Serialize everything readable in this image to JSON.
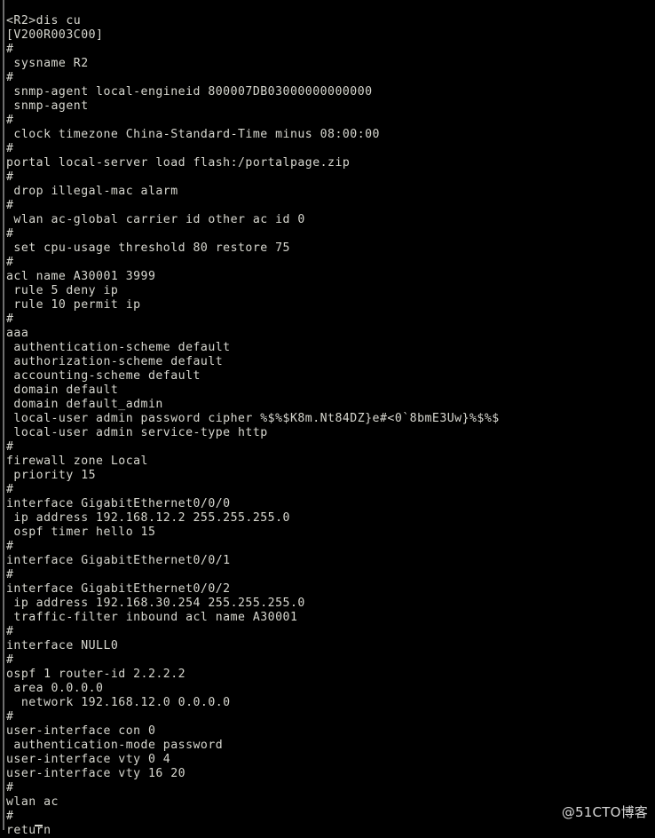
{
  "terminal": {
    "background_color": "#000000",
    "text_color": "#d8d8d0",
    "gutter_color": "#6e6e6e",
    "prompt": "<R2>",
    "command": "dis cu",
    "version_banner": "[V200R003C00]",
    "lines": [
      "<R2>dis cu",
      "[V200R003C00]",
      "#",
      " sysname R2",
      "#",
      " snmp-agent local-engineid 800007DB03000000000000",
      " snmp-agent",
      "#",
      " clock timezone China-Standard-Time minus 08:00:00",
      "#",
      "portal local-server load flash:/portalpage.zip",
      "#",
      " drop illegal-mac alarm",
      "#",
      " wlan ac-global carrier id other ac id 0",
      "#",
      " set cpu-usage threshold 80 restore 75",
      "#",
      "acl name A30001 3999",
      " rule 5 deny ip",
      " rule 10 permit ip",
      "#",
      "aaa",
      " authentication-scheme default",
      " authorization-scheme default",
      " accounting-scheme default",
      " domain default",
      " domain default_admin",
      " local-user admin password cipher %$%$K8m.Nt84DZ}e#<0`8bmE3Uw}%$%$",
      " local-user admin service-type http",
      "#",
      "firewall zone Local",
      " priority 15",
      "#",
      "interface GigabitEthernet0/0/0",
      " ip address 192.168.12.2 255.255.255.0",
      " ospf timer hello 15",
      "#",
      "interface GigabitEthernet0/0/1",
      "#",
      "interface GigabitEthernet0/0/2",
      " ip address 192.168.30.254 255.255.255.0",
      " traffic-filter inbound acl name A30001",
      "#",
      "interface NULL0",
      "#",
      "ospf 1 router-id 2.2.2.2",
      " area 0.0.0.0",
      "  network 192.168.12.0 0.0.0.0",
      "#",
      "user-interface con 0",
      " authentication-mode password",
      "user-interface vty 0 4",
      "user-interface vty 16 20",
      "#",
      "wlan ac",
      "#",
      "return"
    ]
  },
  "watermark": {
    "text": "@51CTO博客"
  }
}
